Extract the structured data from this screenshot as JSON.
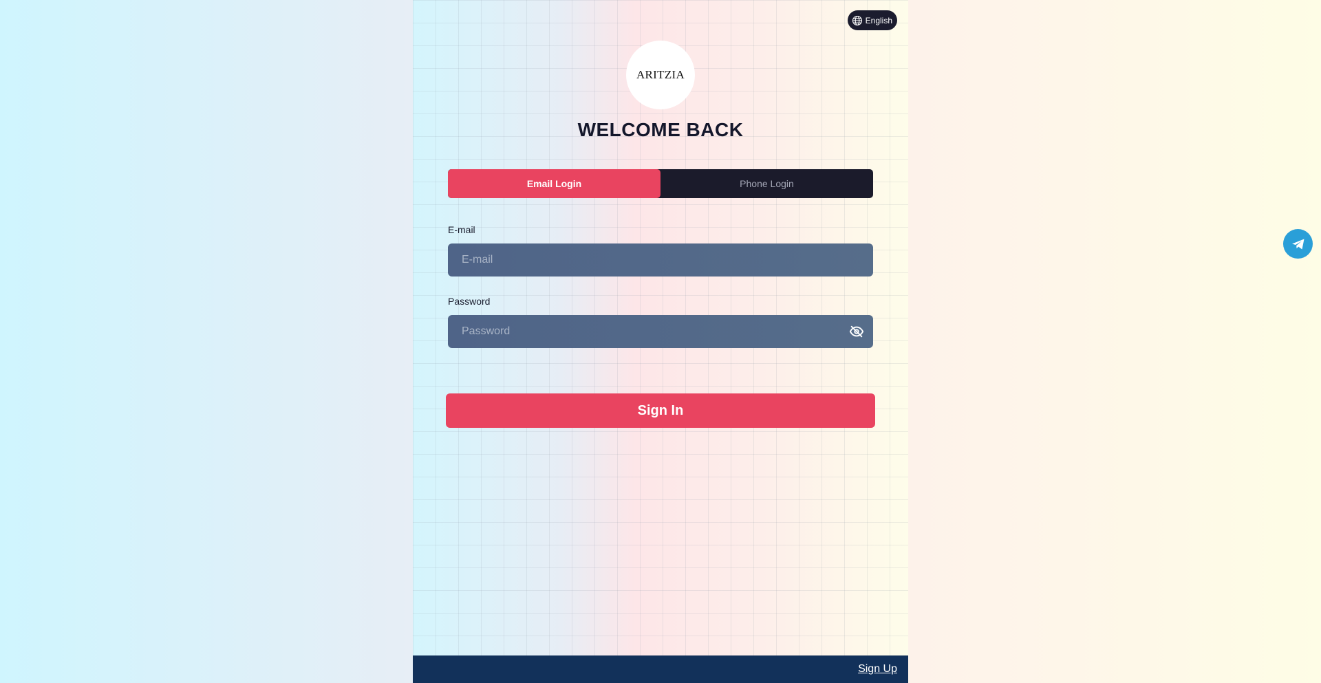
{
  "language": {
    "label": "English",
    "icon": "globe-icon"
  },
  "logo": {
    "text": "ARITZIA"
  },
  "heading": "WELCOME BACK",
  "tabs": [
    {
      "label": "Email Login",
      "active": true
    },
    {
      "label": "Phone Login",
      "active": false
    }
  ],
  "form": {
    "email": {
      "label": "E-mail",
      "placeholder": "E-mail",
      "value": ""
    },
    "password": {
      "label": "Password",
      "placeholder": "Password",
      "value": "",
      "toggle_icon": "eye-off-icon"
    },
    "submit_label": "Sign In"
  },
  "footer": {
    "signup_label": "Sign Up"
  },
  "floating": {
    "icon": "telegram-icon"
  },
  "colors": {
    "accent": "#e94460",
    "dark": "#1b1b2b",
    "input_bg": "#526889",
    "footer_bg": "#12315a",
    "telegram": "#2a9fd8"
  }
}
